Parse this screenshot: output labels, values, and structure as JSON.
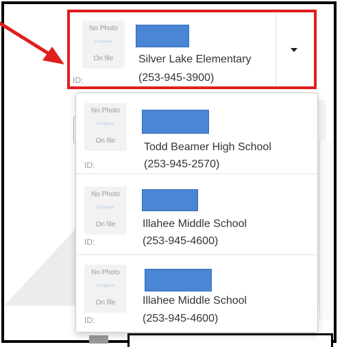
{
  "selected": {
    "photo_text": "No Photo",
    "photo_logo": "Edugeant",
    "photo_sub": "On file",
    "id_label": "ID:",
    "school": "Silver Lake Elementary",
    "phone": "(253-945-3900)"
  },
  "options": [
    {
      "photo_text": "No Photo",
      "photo_logo": "Edugeant",
      "photo_sub": "On file",
      "id_label": "ID:",
      "school": "Todd Beamer High School",
      "phone": "(253-945-2570)"
    },
    {
      "photo_text": "No Photo",
      "photo_logo": "Edugeant",
      "photo_sub": "On file",
      "id_label": "ID:",
      "school": "Illahee Middle School",
      "phone": "(253-945-4600)"
    },
    {
      "photo_text": "No Photo",
      "photo_logo": "Edugeant",
      "photo_sub": "On file",
      "id_label": "ID:",
      "school": "Illahee Middle School",
      "phone": "(253-945-4600)"
    }
  ],
  "colors": {
    "highlight_border": "#e01e1e",
    "redaction": "#4a86d3",
    "arrow": "#e01e1e"
  },
  "icons": {
    "dropdown": "caret-down-icon",
    "annotation": "red-arrow-icon"
  }
}
